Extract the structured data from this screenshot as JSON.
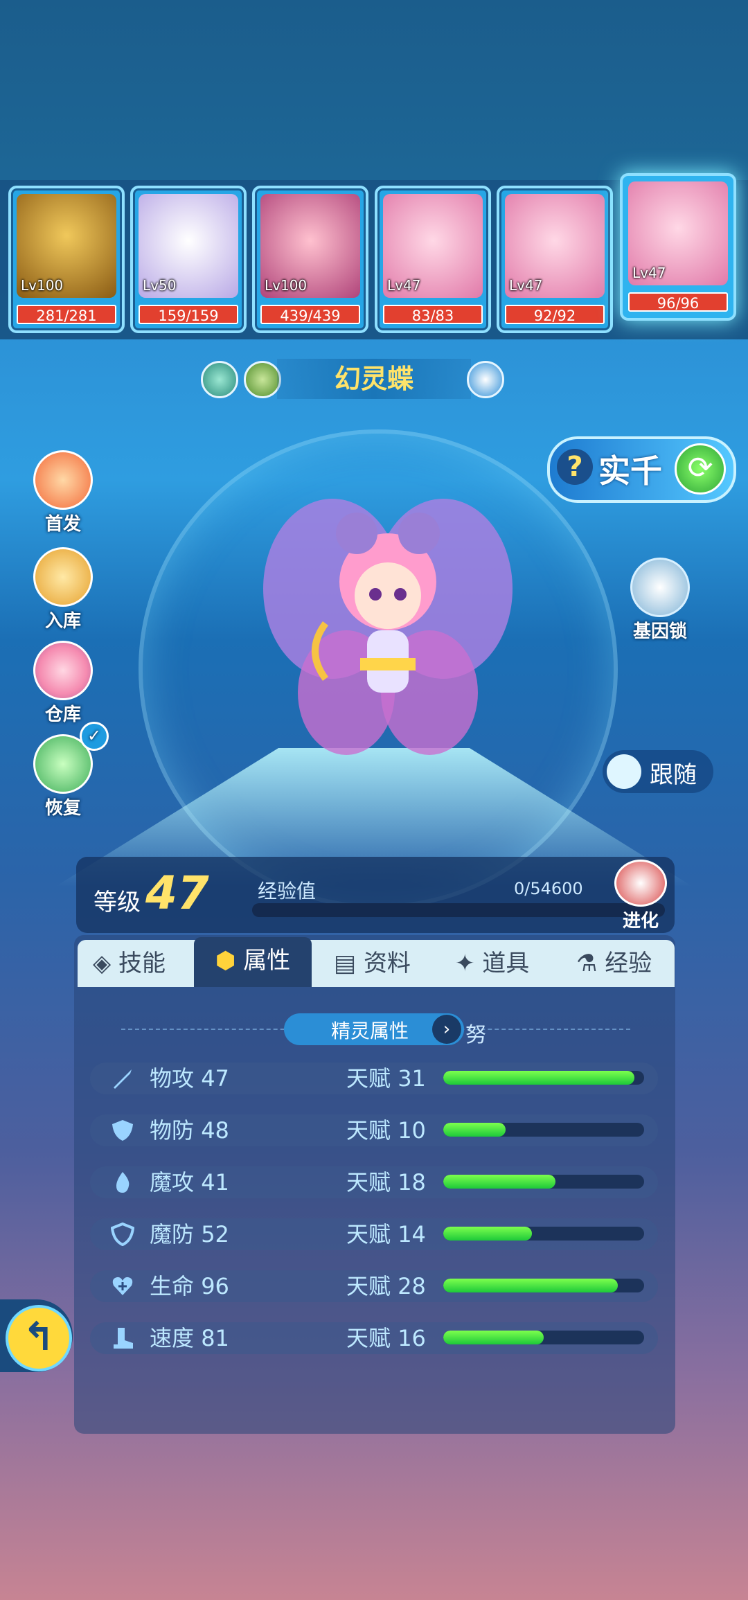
{
  "party": [
    {
      "level": "Lv100",
      "hp": "281/281",
      "avatar": "golden-bird-icon"
    },
    {
      "level": "Lv50",
      "hp": "159/159",
      "avatar": "white-beast-icon"
    },
    {
      "level": "Lv100",
      "hp": "439/439",
      "avatar": "pink-demon-icon"
    },
    {
      "level": "Lv47",
      "hp": "83/83",
      "avatar": "pink-fairy-icon"
    },
    {
      "level": "Lv47",
      "hp": "92/92",
      "avatar": "pink-fairy-icon"
    },
    {
      "level": "Lv47",
      "hp": "96/96",
      "avatar": "pink-fairy-icon"
    }
  ],
  "pet": {
    "name": "幻灵蝶"
  },
  "right_buttons": {
    "shiqian": "实千",
    "gene_lock": "基因锁",
    "follow": "跟随"
  },
  "side_buttons": [
    "首发",
    "入库",
    "仓库",
    "恢复"
  ],
  "level_section": {
    "level_label": "等级",
    "level": "47",
    "exp_label": "经验值",
    "exp": "0/54600",
    "evolve": "进化"
  },
  "tabs": [
    "技能",
    "属性",
    "资料",
    "道具",
    "经验"
  ],
  "active_tab": "属性",
  "stats_header": {
    "title": "精灵属性",
    "nature": "努"
  },
  "talent_label": "天赋",
  "stats": [
    {
      "name": "物攻",
      "value": "47",
      "talent": "31",
      "talent_fraction": 0.95
    },
    {
      "name": "物防",
      "value": "48",
      "talent": "10",
      "talent_fraction": 0.31
    },
    {
      "name": "魔攻",
      "value": "41",
      "talent": "18",
      "talent_fraction": 0.56
    },
    {
      "name": "魔防",
      "value": "52",
      "talent": "14",
      "talent_fraction": 0.44
    },
    {
      "name": "生命",
      "value": "96",
      "talent": "28",
      "talent_fraction": 0.87
    },
    {
      "name": "速度",
      "value": "81",
      "talent": "16",
      "talent_fraction": 0.5
    }
  ],
  "colors": {
    "accent": "#ffe36a",
    "hp_bar": "#e2402f",
    "talent_fill": "#2ad43c"
  }
}
